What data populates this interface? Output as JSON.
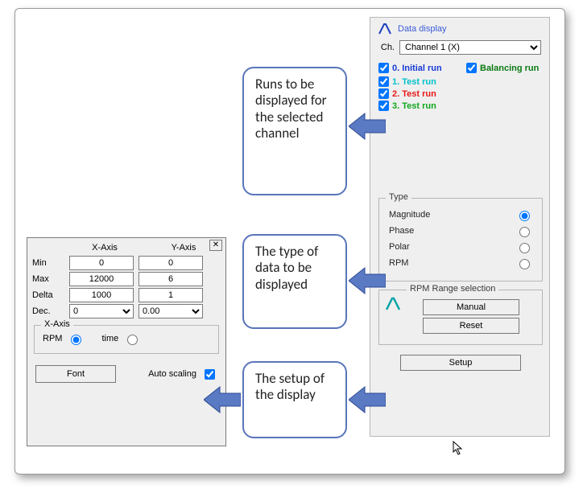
{
  "right": {
    "title": "Data display",
    "ch_label": "Ch.",
    "channel": "Channel 1 (X)",
    "runs_col1": [
      {
        "label": "0.  Initial run",
        "color": "col-blue"
      }
    ],
    "runs_col2": [
      {
        "label": "Balancing run",
        "color": "col-dkgreen"
      }
    ],
    "runs_more": [
      {
        "label": "1.  Test run",
        "color": "col-teal"
      },
      {
        "label": "2.  Test run",
        "color": "col-red"
      },
      {
        "label": "3.  Test run",
        "color": "col-green"
      }
    ],
    "type_legend": "Type",
    "type_options": [
      "Magnitude",
      "Phase",
      "Polar",
      "RPM"
    ],
    "type_selected": 0,
    "rpm_legend": "RPM Range selection",
    "manual_label": "Manual",
    "reset_label": "Reset",
    "setup_label": "Setup"
  },
  "axis": {
    "xhead": "X-Axis",
    "yhead": "Y-Axis",
    "rows": {
      "min": {
        "label": "Min",
        "x": "0",
        "y": "0"
      },
      "max": {
        "label": "Max",
        "x": "12000",
        "y": "6"
      },
      "delta": {
        "label": "Delta",
        "x": "1000",
        "y": "1"
      },
      "dec": {
        "label": "Dec.",
        "x": "0",
        "y": "0.00"
      }
    },
    "xgroup_legend": "X-Axis",
    "rpm_label": "RPM",
    "time_label": "time",
    "xaxis_selected": "RPM",
    "font_label": "Font",
    "autoscale_label": "Auto scaling",
    "autoscale_checked": true
  },
  "callouts": {
    "c1": "Runs to be displayed for the selected channel",
    "c2": "The type of data to be displayed",
    "c3": "The setup of the display"
  }
}
